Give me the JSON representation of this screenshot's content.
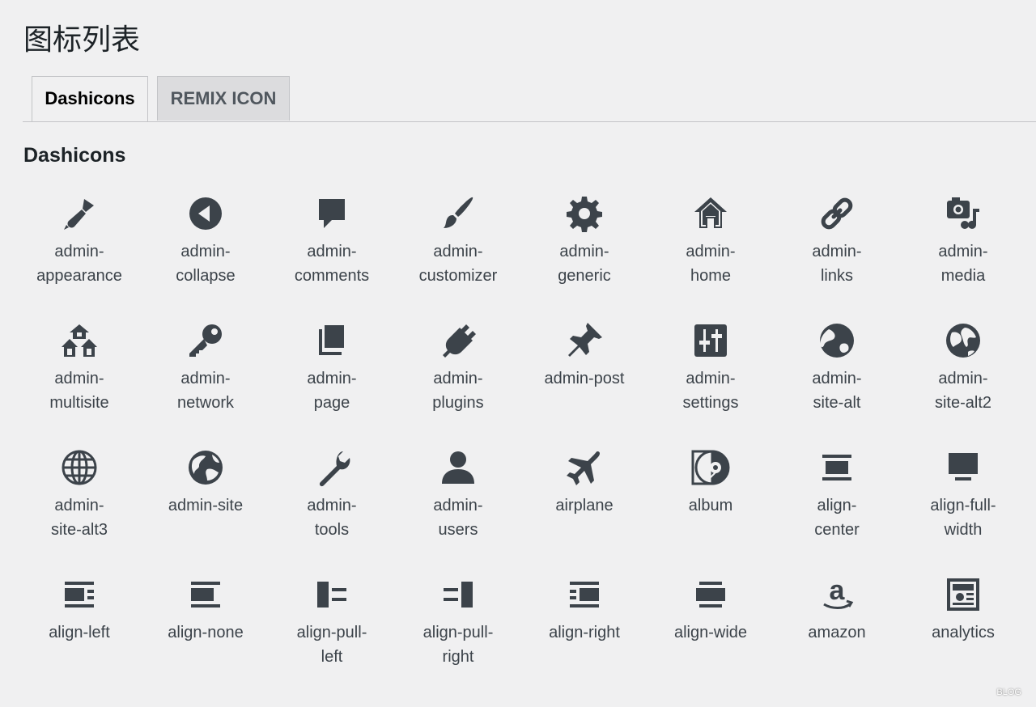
{
  "page": {
    "title": "图标列表"
  },
  "tabs": [
    {
      "label": "Dashicons"
    },
    {
      "label": "REMIX ICON"
    }
  ],
  "section": {
    "title": "Dashicons"
  },
  "icons": [
    {
      "label": "admin-\nappearance",
      "icon": "paintbrush-icon"
    },
    {
      "label": "admin-\ncollapse",
      "icon": "collapse-icon"
    },
    {
      "label": "admin-\ncomments",
      "icon": "comment-icon"
    },
    {
      "label": "admin-\ncustomizer",
      "icon": "brush-icon"
    },
    {
      "label": "admin-\ngeneric",
      "icon": "gear-icon"
    },
    {
      "label": "admin-\nhome",
      "icon": "home-icon"
    },
    {
      "label": "admin-\nlinks",
      "icon": "link-icon"
    },
    {
      "label": "admin-\nmedia",
      "icon": "media-icon"
    },
    {
      "label": "admin-\nmultisite",
      "icon": "multisite-icon"
    },
    {
      "label": "admin-\nnetwork",
      "icon": "key-icon"
    },
    {
      "label": "admin-\npage",
      "icon": "pages-icon"
    },
    {
      "label": "admin-\nplugins",
      "icon": "plug-icon"
    },
    {
      "label": "admin-post",
      "icon": "pushpin-icon"
    },
    {
      "label": "admin-\nsettings",
      "icon": "sliders-icon"
    },
    {
      "label": "admin-\nsite-alt",
      "icon": "globe-icon"
    },
    {
      "label": "admin-\nsite-alt2",
      "icon": "globe-alt2-icon"
    },
    {
      "label": "admin-\nsite-alt3",
      "icon": "globe-wire-icon"
    },
    {
      "label": "admin-site",
      "icon": "earth-icon"
    },
    {
      "label": "admin-\ntools",
      "icon": "wrench-icon"
    },
    {
      "label": "admin-\nusers",
      "icon": "user-icon"
    },
    {
      "label": "airplane",
      "icon": "airplane-icon"
    },
    {
      "label": "album",
      "icon": "album-icon"
    },
    {
      "label": "align-\ncenter",
      "icon": "align-center-icon"
    },
    {
      "label": "align-full-\nwidth",
      "icon": "align-full-width-icon"
    },
    {
      "label": "align-left",
      "icon": "align-left-icon"
    },
    {
      "label": "align-none",
      "icon": "align-none-icon"
    },
    {
      "label": "align-pull-\nleft",
      "icon": "align-pull-left-icon"
    },
    {
      "label": "align-pull-\nright",
      "icon": "align-pull-right-icon"
    },
    {
      "label": "align-right",
      "icon": "align-right-icon"
    },
    {
      "label": "align-wide",
      "icon": "align-wide-icon"
    },
    {
      "label": "amazon",
      "icon": "amazon-icon"
    },
    {
      "label": "analytics",
      "icon": "analytics-icon"
    }
  ],
  "watermark": {
    "text": "BLOG"
  }
}
